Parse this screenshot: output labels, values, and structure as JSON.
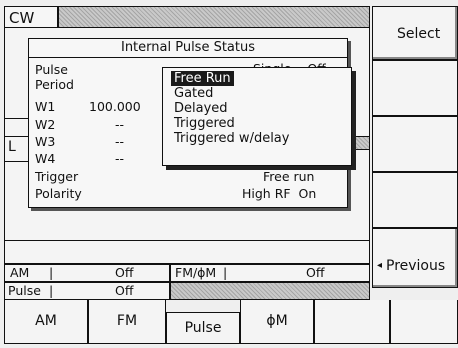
{
  "display": {
    "mode_title": "CW"
  },
  "dialog": {
    "title": "Internal Pulse Status",
    "rows": [
      {
        "label": "Pulse",
        "value": ""
      },
      {
        "label": "Period",
        "value": ""
      },
      {
        "label": "W1",
        "value": "100.000"
      },
      {
        "label": "W2",
        "value": "--"
      },
      {
        "label": "W3",
        "value": "--"
      },
      {
        "label": "W4",
        "value": "--"
      }
    ],
    "partial_value": "Single    Off",
    "trigger_label": "Trigger",
    "trigger_value": "Free run",
    "polarity_label": "Polarity",
    "polarity_value": "High RF  On"
  },
  "underlying_panel": {
    "letter": "L"
  },
  "menu": {
    "items": [
      "Free Run",
      "Gated",
      "Delayed",
      "Triggered",
      "Triggered w/delay"
    ],
    "selected_index": 0
  },
  "status": {
    "am_label": "AM",
    "am_value": "Off",
    "fm_pm_label": "FM/ϕM",
    "fm_pm_value": "Off",
    "pulse_label": "Pulse",
    "pulse_value": "Off"
  },
  "softkeys": {
    "select": "Select",
    "previous": "Previous",
    "previous_arrow": "◂"
  },
  "tabs": [
    "AM",
    "FM",
    "Pulse",
    "ϕM",
    "",
    ""
  ]
}
